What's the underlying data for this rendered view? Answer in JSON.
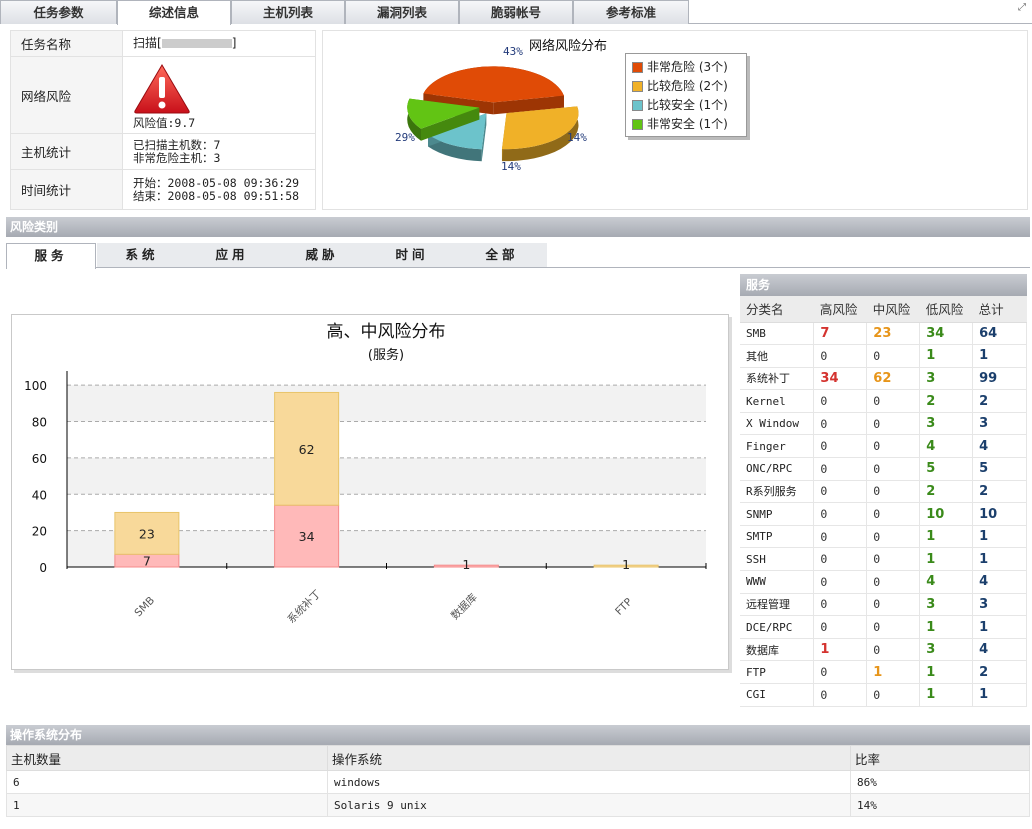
{
  "top_tabs": [
    {
      "label": "任务参数",
      "active": false
    },
    {
      "label": "综述信息",
      "active": true
    },
    {
      "label": "主机列表",
      "active": false
    },
    {
      "label": "漏洞列表",
      "active": false
    },
    {
      "label": "脆弱帐号",
      "active": false
    },
    {
      "label": "参考标准",
      "active": false
    }
  ],
  "info": {
    "task_name_label": "任务名称",
    "task_name_prefix": "扫描[",
    "task_name_suffix": "]",
    "risk_label": "网络风险",
    "risk_value": "风险值:9.7",
    "host_label": "主机统计",
    "hosts_scanned": "已扫描主机数：7",
    "hosts_critical": "非常危险主机：3",
    "time_label": "时间统计",
    "time_start": "开始：2008-05-08 09:36:29",
    "time_end": "结束：2008-05-08 09:51:58"
  },
  "pie": {
    "title": "网络风险分布",
    "legend": [
      {
        "label": "非常危险 (3个)",
        "color": "#e04b06"
      },
      {
        "label": "比较危险 (2个)",
        "color": "#f0b128"
      },
      {
        "label": "比较安全 (1个)",
        "color": "#6cc3cb"
      },
      {
        "label": "非常安全 (1个)",
        "color": "#62c414"
      }
    ]
  },
  "risk_category_title": "风险类别",
  "sub_tabs": [
    {
      "label": "服务",
      "active": true
    },
    {
      "label": "系统",
      "active": false
    },
    {
      "label": "应用",
      "active": false
    },
    {
      "label": "威胁",
      "active": false
    },
    {
      "label": "时间",
      "active": false
    },
    {
      "label": "全部",
      "active": false
    }
  ],
  "chart_data": [
    {
      "type": "pie",
      "title": "网络风险分布",
      "labels": [
        "非常危险 (3个)",
        "比较危险 (2个)",
        "比较安全 (1个)",
        "非常安全 (1个)"
      ],
      "values": [
        43,
        29,
        14,
        14
      ],
      "value_labels": [
        "43%",
        "29%",
        "14%",
        "14%"
      ],
      "colors": [
        "#e04b06",
        "#f0b128",
        "#6cc3cb",
        "#62c414"
      ],
      "legend": "right"
    },
    {
      "type": "bar",
      "stacked": true,
      "title": "高、中风险分布",
      "subtitle": "(服务)",
      "categories": [
        "SMB",
        "系统补丁",
        "数据库",
        "FTP"
      ],
      "series": [
        {
          "values": [
            7,
            34,
            1,
            0
          ],
          "color": "#ffb9b9"
        },
        {
          "values": [
            23,
            62,
            0,
            1
          ],
          "color": "#f8d99a"
        }
      ],
      "yticks": [
        0,
        20,
        40,
        60,
        80,
        100
      ],
      "ylim": [
        0,
        110
      ],
      "grid": true
    }
  ],
  "service_table": {
    "title": "服务",
    "headers": [
      "分类名",
      "高风险",
      "中风险",
      "低风险",
      "总计"
    ],
    "rows": [
      [
        "SMB",
        "7",
        "23",
        "34",
        "64"
      ],
      [
        "其他",
        "0",
        "0",
        "1",
        "1"
      ],
      [
        "系统补丁",
        "34",
        "62",
        "3",
        "99"
      ],
      [
        "Kernel",
        "0",
        "0",
        "2",
        "2"
      ],
      [
        "X Window",
        "0",
        "0",
        "3",
        "3"
      ],
      [
        "Finger",
        "0",
        "0",
        "4",
        "4"
      ],
      [
        "ONC/RPC",
        "0",
        "0",
        "5",
        "5"
      ],
      [
        "R系列服务",
        "0",
        "0",
        "2",
        "2"
      ],
      [
        "SNMP",
        "0",
        "0",
        "10",
        "10"
      ],
      [
        "SMTP",
        "0",
        "0",
        "1",
        "1"
      ],
      [
        "SSH",
        "0",
        "0",
        "1",
        "1"
      ],
      [
        "WWW",
        "0",
        "0",
        "4",
        "4"
      ],
      [
        "远程管理",
        "0",
        "0",
        "3",
        "3"
      ],
      [
        "DCE/RPC",
        "0",
        "0",
        "1",
        "1"
      ],
      [
        "数据库",
        "1",
        "0",
        "3",
        "4"
      ],
      [
        "FTP",
        "0",
        "1",
        "1",
        "2"
      ],
      [
        "CGI",
        "0",
        "0",
        "1",
        "1"
      ]
    ]
  },
  "os_section": {
    "title": "操作系统分布",
    "headers": [
      "主机数量",
      "操作系统",
      "比率"
    ],
    "rows": [
      [
        "6",
        "windows",
        "86%"
      ],
      [
        "1",
        "Solaris 9 unix",
        "14%"
      ]
    ]
  }
}
